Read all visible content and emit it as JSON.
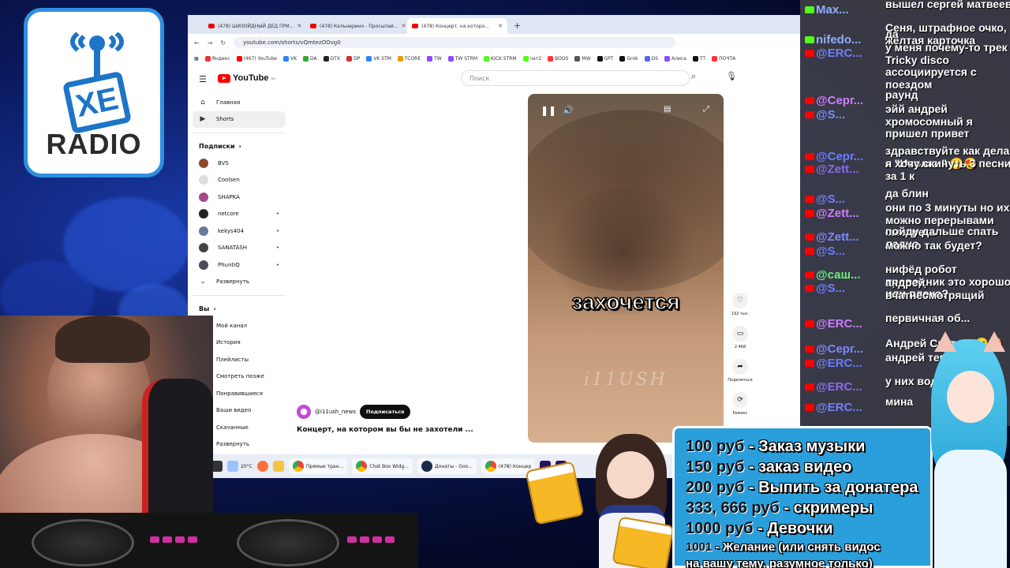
{
  "logo": {
    "brand": "XE",
    "radio": "RADIO"
  },
  "browser": {
    "tabs": [
      {
        "label": "(478) ШИЗОЙДНЫЙ ДЕД ПРИ..."
      },
      {
        "label": "(478) Кельнерино - Просыпай..."
      },
      {
        "label": "(478) Концерт, на которо..."
      }
    ],
    "url": "youtube.com/shorts/vQmtezOOvg0",
    "bookmarks": [
      "Яндекс",
      "(467) YouTube",
      "VK",
      "DA",
      "DTX",
      "DP",
      "VK STM",
      "TCORE",
      "TW",
      "TW STRM",
      "KICK STRM",
      "чат2",
      "BOOS",
      "MW",
      "GPT",
      "Grok",
      "DS",
      "Алиса",
      "TT",
      "ПОЧТА"
    ]
  },
  "youtube": {
    "logo": "YouTube",
    "logo_region": "RU",
    "search_placeholder": "Поиск",
    "sidebar": {
      "home": "Главная",
      "shorts": "Shorts",
      "subs_header": "Подписки",
      "channels": [
        "BVS",
        "Coolsen",
        "SHAPKA",
        "netcore",
        "kekys404",
        "SANATASH",
        "PhuntiQ"
      ],
      "expand": "Развернуть",
      "you_header": "Вы",
      "you_items": [
        "Мой канал",
        "История",
        "Плейлисты",
        "Смотреть позже",
        "Понравившиеся",
        "Ваши видео",
        "Скачанные",
        "Развернуть"
      ]
    },
    "video": {
      "caption": "захочется",
      "watermark": "i11USH"
    },
    "actions": {
      "likes": "192 тыс.",
      "comments": "2 468",
      "share": "Поделиться",
      "remix": "Ремикс"
    },
    "channel": "@i11ush_news",
    "subscribe": "Подписаться",
    "title": "Концерт, на котором вы бы не захотели ..."
  },
  "taskbar": {
    "weather": "20°C",
    "apps": [
      "Прямые тран...",
      "Chat Box Widg...",
      "Донаты - Goo...",
      "(478) Концер"
    ]
  },
  "chat": {
    "rows": [
      {
        "name": "Max...",
        "platform": "kick",
        "msg": "вышел сергей матвеев"
      },
      {
        "name": "",
        "platform": "",
        "msg": "Сеня, штрафное очко, желтая карточка"
      },
      {
        "name": "nifedo...",
        "platform": "kick",
        "msg": "да"
      },
      {
        "name": "@ERC...",
        "platform": "youtube",
        "msg": "у меня почему-то трек Tricky disco ассоциируется с поездом"
      },
      {
        "name": "@Серг...",
        "platform": "youtube",
        "msg": "раунд"
      },
      {
        "name": "@S...",
        "platform": "youtube",
        "msg": "эйй андрей хромосомный я пришел привет"
      },
      {
        "name": "@Серг...",
        "platform": "youtube",
        "msg": "здравствуйте как дела а \"Иволга \" 🤭😍"
      },
      {
        "name": "@Zett...",
        "platform": "youtube",
        "msg": "я хочу скинуть 3 песни за 1 к"
      },
      {
        "name": "@S...",
        "platform": "youtube",
        "msg": "да блин"
      },
      {
        "name": "@Zett...",
        "platform": "youtube",
        "msg": "они по 3 минуты но их можно перерывами смотреть"
      },
      {
        "name": "@Zett...",
        "platform": "youtube",
        "msg": "пойду дальше спать ладно"
      },
      {
        "name": "@S...",
        "platform": "youtube",
        "msg": "можно так будет?"
      },
      {
        "name": "@саш...",
        "platform": "youtube",
        "msg": "нифёд робот проводник это хорошо или плохо?"
      },
      {
        "name": "@S...",
        "platform": "youtube",
        "msg": "андрей вчатнесмотрящий"
      },
      {
        "name": "@ERC...",
        "platform": "youtube",
        "msg": "первичная об..."
      },
      {
        "name": "@Серг...",
        "platform": "youtube",
        "msg": "Андрей Светл... 😄😍"
      },
      {
        "name": "@ERC...",
        "platform": "youtube",
        "msg": "андрей тепли..."
      },
      {
        "name": "@ERC...",
        "platform": "youtube",
        "msg": "у них вода до..."
      },
      {
        "name": "@ERC...",
        "platform": "youtube",
        "msg": "мина"
      }
    ]
  },
  "donations": [
    {
      "price": "100 руб",
      "text": " - Заказ музыки"
    },
    {
      "price": "150 руб",
      "text": " - заказ видео"
    },
    {
      "price": "200 руб",
      "text": " - Выпить за донатера"
    },
    {
      "price": "333, 666 руб",
      "text": " - скримеры"
    },
    {
      "price": "1000 руб",
      "text": " - Девочки"
    },
    {
      "price": "1001",
      "text": " - Желание (или снять видос"
    },
    {
      "price": "",
      "text": "на вашу тему, разумное только)"
    }
  ],
  "colors": {
    "youtube_red": "#ff0000",
    "kick_green": "#53fc18",
    "donation_bg": "#2a9fdc",
    "chat_bg": "#4a4a50"
  }
}
